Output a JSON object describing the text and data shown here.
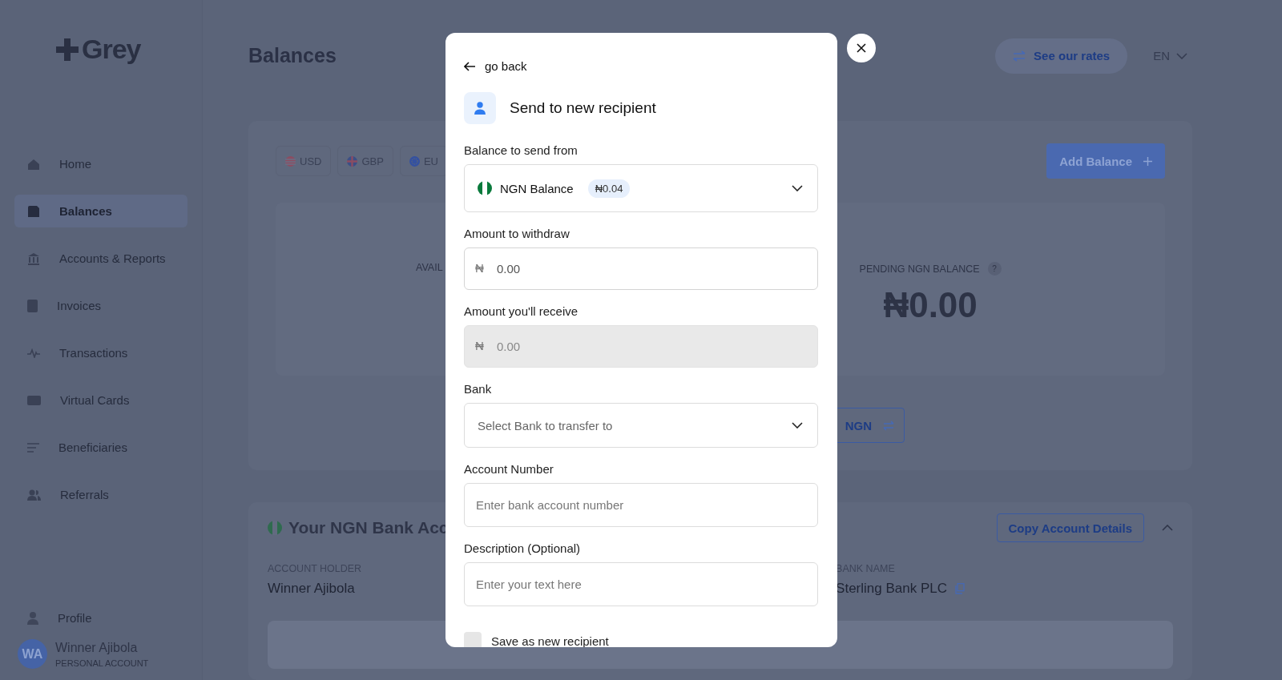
{
  "sidebar": {
    "logo": "Grey",
    "items": [
      {
        "label": "Home",
        "selected": false
      },
      {
        "label": "Balances",
        "selected": true
      },
      {
        "label": "Accounts & Reports",
        "selected": false
      },
      {
        "label": "Invoices",
        "selected": false
      },
      {
        "label": "Transactions",
        "selected": false
      },
      {
        "label": "Virtual Cards",
        "selected": false
      },
      {
        "label": "Beneficiaries",
        "selected": false
      },
      {
        "label": "Referrals",
        "selected": false
      }
    ],
    "profile_item": {
      "label": "Profile"
    },
    "user": {
      "initials": "WA",
      "name": "Winner Ajibola",
      "account_type": "PERSONAL ACCOUNT"
    }
  },
  "header": {
    "title": "Balances",
    "rates_button": "See our rates",
    "language": "EN"
  },
  "balances_card": {
    "currency_tabs": [
      {
        "label": "USD",
        "selected": false
      },
      {
        "label": "GBP",
        "selected": false
      },
      {
        "label": "EU",
        "selected": false
      }
    ],
    "add_balance_button": "Add Balance",
    "available_label": "AVAIL",
    "pending_label": "PENDING NGN BALANCE",
    "pending_help": "?",
    "pending_amount": "₦0.00",
    "convert_button": "NGN"
  },
  "bank_account_card": {
    "title": "Your NGN Bank Acc",
    "copy_button": "Copy Account Details",
    "expanded": true,
    "fields": [
      {
        "label": "ACCOUNT HOLDER",
        "value": "Winner Ajibola",
        "copyable": false
      },
      {
        "label": "BANK NAME",
        "value": "Sterling Bank PLC",
        "copyable": true
      }
    ]
  },
  "modal": {
    "back_link": "go back",
    "title": "Send to new recipient",
    "fields": [
      {
        "kind": "select",
        "label": "Balance to send from",
        "value": "NGN Balance",
        "badge": "₦0.04"
      },
      {
        "kind": "amount",
        "label": "Amount to withdraw",
        "currency": "₦",
        "placeholder": "0.00",
        "disabled": false
      },
      {
        "kind": "amount",
        "label": "Amount you'll receive",
        "currency": "₦",
        "placeholder": "0.00",
        "disabled": true
      },
      {
        "kind": "select",
        "label": "Bank",
        "placeholder": "Select Bank to transfer to"
      },
      {
        "kind": "text",
        "label": "Account Number",
        "placeholder": "Enter bank account number"
      },
      {
        "kind": "text",
        "label": "Description (Optional)",
        "placeholder": "Enter your text here"
      }
    ],
    "save_recipient": {
      "label": "Save as new recipient",
      "checked": false
    }
  }
}
